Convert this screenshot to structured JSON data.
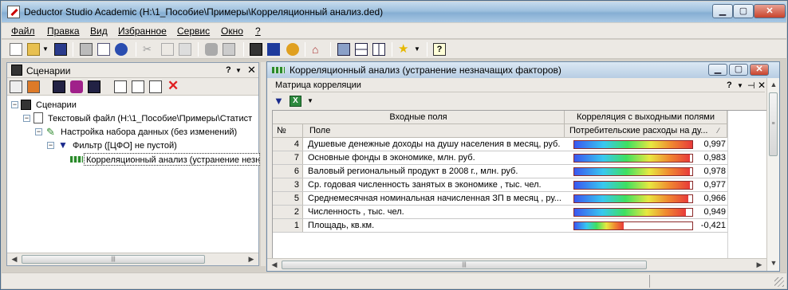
{
  "window": {
    "title": "Deductor Studio Academic (H:\\1_Пособие\\Примеры\\Корреляционный анализ.ded)"
  },
  "menu": [
    "Файл",
    "Правка",
    "Вид",
    "Избранное",
    "Сервис",
    "Окно",
    "?"
  ],
  "scenarios": {
    "title": "Сценарии",
    "hint": "?",
    "tree": [
      "Сценарии",
      "Текстовый файл (H:\\1_Пособие\\Примеры\\Статист",
      "Настройка набора данных (без изменений)",
      "Фильтр ([ЦФО] не пустой)",
      "Корреляционный анализ (устранение незн"
    ]
  },
  "report": {
    "title": "Корреляционный анализ (устранение незначащих факторов)",
    "subtitle": "Матрица корреляции",
    "hint": "?",
    "group_inputs": "Входные поля",
    "group_corr": "Корреляция с выходными полями",
    "col_num": "№",
    "col_field": "Поле",
    "col_target": "Потребительские расходы на ду...",
    "rows": [
      {
        "num": "4",
        "field": "Душевые денежные доходы на душу населения в месяц, руб.",
        "value": "0,997",
        "level": 0.997
      },
      {
        "num": "7",
        "field": "Основные фонды в экономике, млн. руб.",
        "value": "0,983",
        "level": 0.983
      },
      {
        "num": "6",
        "field": "Валовый региональный продукт в 2008 г., млн. руб.",
        "value": "0,978",
        "level": 0.978
      },
      {
        "num": "3",
        "field": "Ср. годовая численность занятых в экономике  , тыс. чел.",
        "value": "0,977",
        "level": 0.977
      },
      {
        "num": "5",
        "field": "Среднемесячная номинальная начисленная ЗП в месяц , ру...",
        "value": "0,966",
        "level": 0.966
      },
      {
        "num": "2",
        "field": "Численность , тыс. чел.",
        "value": "0,949",
        "level": 0.949
      },
      {
        "num": "1",
        "field": "Площадь,  кв.км.",
        "value": "-0,421",
        "level": 0.421
      }
    ]
  },
  "colors": {
    "bar_border": "#8b2a2a",
    "accent": "#86aed3"
  }
}
